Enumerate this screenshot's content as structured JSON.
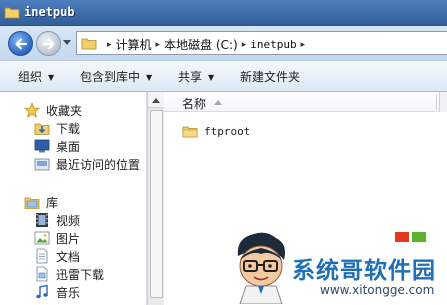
{
  "window": {
    "title": "inetpub"
  },
  "address_bar": {
    "crumbs": [
      "计算机",
      "本地磁盘 (C:)",
      "inetpub"
    ]
  },
  "toolbar": {
    "organize": "组织",
    "include_in_library": "包含到库中",
    "share": "共享",
    "new_folder": "新建文件夹"
  },
  "nav_pane": {
    "favorites": {
      "label": "收藏夹",
      "items": [
        "下载",
        "桌面",
        "最近访问的位置"
      ]
    },
    "libraries": {
      "label": "库",
      "items": [
        "视频",
        "图片",
        "文档",
        "迅雷下载",
        "音乐"
      ]
    }
  },
  "content": {
    "column_header": "名称",
    "files": [
      {
        "name": "ftproot",
        "type": "folder"
      }
    ]
  },
  "watermark": {
    "title": "系统哥软件园",
    "url": "www.xitongge.com"
  },
  "colors": {
    "title_bar": "#3d6aa8",
    "toolbar": "#dde8f4",
    "watermark_text": "#1f6fb8"
  }
}
